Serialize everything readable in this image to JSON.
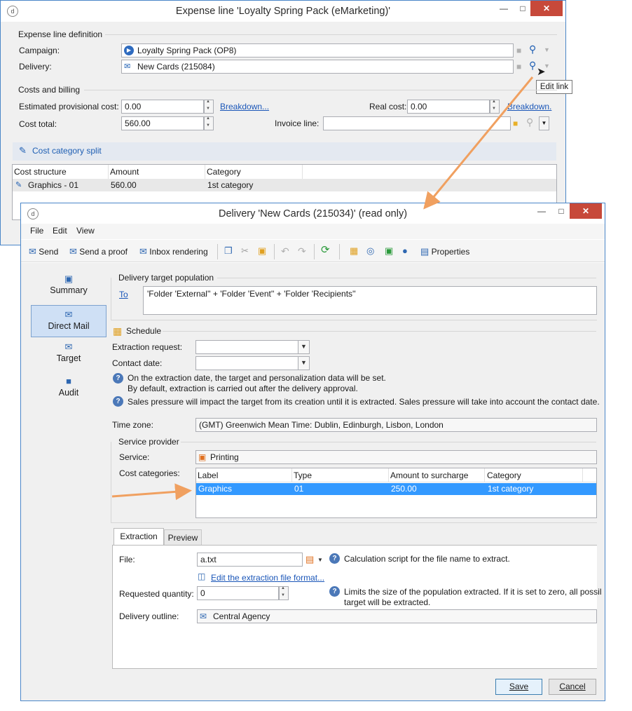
{
  "colors": {
    "accent": "#1f5fb3",
    "selection": "#3399ff",
    "close_button": "#c7493a",
    "arrow": "#f0a060"
  },
  "expense_window": {
    "title": "Expense line 'Loyalty Spring Pack (eMarketing)'",
    "section_definition": "Expense line definition",
    "campaign_label": "Campaign:",
    "campaign_value": "Loyalty Spring Pack (OP8)",
    "delivery_label": "Delivery:",
    "delivery_value": "New Cards (215084)",
    "tooltip": "Edit link",
    "section_costs": "Costs and billing",
    "est_cost_label": "Estimated provisional cost:",
    "est_cost_value": "0.00",
    "breakdown_link": "Breakdown...",
    "real_cost_label": "Real cost:",
    "real_cost_value": "0.00",
    "breakdown_link_2": "Breakdown.",
    "cost_total_label": "Cost total:",
    "cost_total_value": "560.00",
    "invoice_label": "Invoice line:",
    "invoice_value": "",
    "cost_split_label": "Cost category split",
    "table_headers": [
      "Cost structure",
      "Amount",
      "Category"
    ],
    "table_rows": [
      [
        "Graphics - 01",
        "560.00",
        "1st category"
      ]
    ]
  },
  "delivery_window": {
    "title": "Delivery 'New Cards (215034)' (read only)",
    "menu": [
      "File",
      "Edit",
      "View"
    ],
    "toolbar": {
      "send": "Send",
      "send_proof": "Send a proof",
      "inbox": "Inbox rendering",
      "properties": "Properties"
    },
    "nav": [
      "Summary",
      "Direct Mail",
      "Target",
      "Audit"
    ],
    "target_population_legend": "Delivery target population",
    "to_link": "To",
    "to_value": "'Folder 'External'' + 'Folder 'Event'' + 'Folder 'Recipients''",
    "schedule_legend": "Schedule",
    "extraction_request_label": "Extraction request:",
    "extraction_request_value": "",
    "contact_date_label": "Contact date:",
    "contact_date_value": "",
    "info_1a": "On the extraction date, the target and personalization data will be set.",
    "info_1b": "By default, extraction is carried out after the delivery approval.",
    "info_2": "Sales pressure will impact the target from its creation until it is extracted. Sales pressure will take into account the contact date.",
    "timezone_label": "Time zone:",
    "timezone_value": "(GMT) Greenwich Mean Time: Dublin, Edinburgh, Lisbon, London",
    "service_provider_legend": "Service provider",
    "service_label": "Service:",
    "service_value": "Printing",
    "cost_categories_label": "Cost categories:",
    "cc_headers": [
      "Label",
      "Type",
      "Amount to surcharge",
      "Category"
    ],
    "cc_rows": [
      [
        "Graphics",
        "01",
        "250.00",
        "1st category"
      ]
    ],
    "tabs": [
      "Extraction",
      "Preview"
    ],
    "file_label": "File:",
    "file_value": "a.txt",
    "file_help": "Calculation script for the file name to extract.",
    "edit_format_link": "Edit the extraction file format...",
    "req_qty_label": "Requested quantity:",
    "req_qty_value": "0",
    "req_qty_help_1": "Limits the size of the population extracted. If it is set to zero, all possil",
    "req_qty_help_2": "target will be extracted.",
    "outline_label": "Delivery outline:",
    "outline_value": "Central Agency",
    "save": "Save",
    "cancel": "Cancel"
  }
}
